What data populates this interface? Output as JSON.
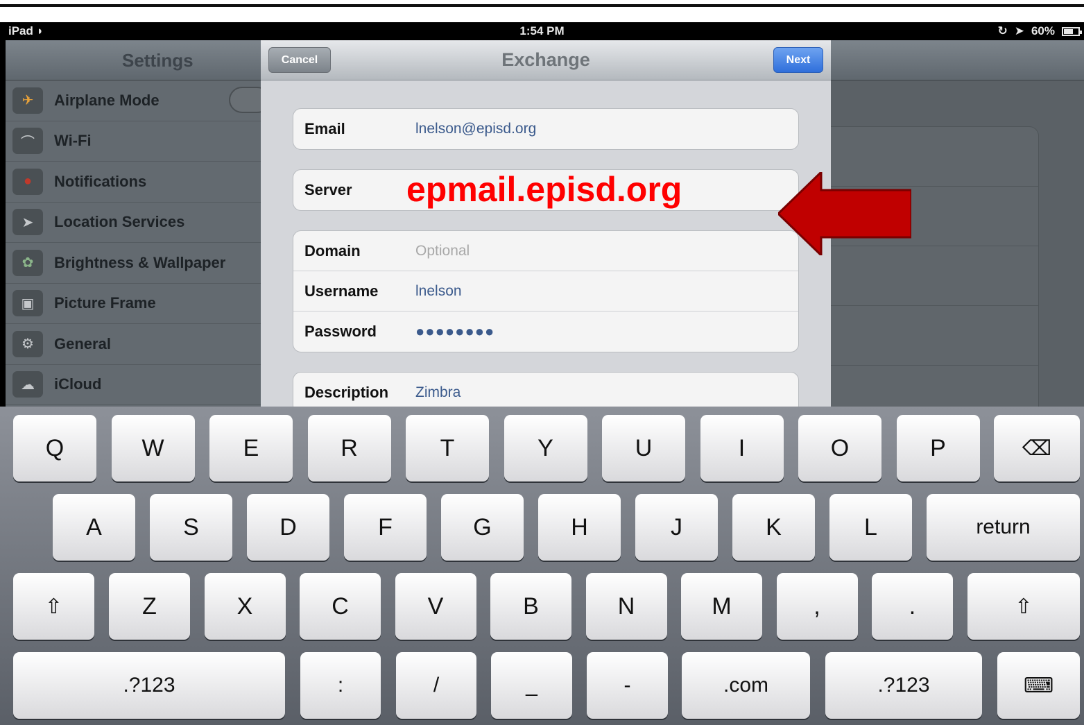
{
  "status_bar": {
    "device": "iPad",
    "time": "1:54 PM",
    "battery": "60%"
  },
  "settings": {
    "title": "Settings",
    "items": [
      {
        "label": "Airplane Mode",
        "icon": "airplane-icon"
      },
      {
        "label": "Wi-Fi",
        "icon": "wifi-icon"
      },
      {
        "label": "Notifications",
        "icon": "notifications-icon"
      },
      {
        "label": "Location Services",
        "icon": "location-icon"
      },
      {
        "label": "Brightness & Wallpaper",
        "icon": "wallpaper-icon"
      },
      {
        "label": "Picture Frame",
        "icon": "picture-frame-icon"
      },
      {
        "label": "General",
        "icon": "gear-icon"
      },
      {
        "label": "iCloud",
        "icon": "cloud-icon"
      }
    ]
  },
  "modal": {
    "title": "Exchange",
    "cancel_label": "Cancel",
    "next_label": "Next",
    "email": {
      "label": "Email",
      "value": "lnelson@episd.org"
    },
    "server": {
      "label": "Server",
      "value": "epmail.episd.org"
    },
    "domain": {
      "label": "Domain",
      "placeholder": "Optional"
    },
    "username": {
      "label": "Username",
      "value": "lnelson"
    },
    "password": {
      "label": "Password",
      "value": "●●●●●●●●"
    },
    "description": {
      "label": "Description",
      "value": "Zimbra"
    }
  },
  "keyboard": {
    "row1": [
      "Q",
      "W",
      "E",
      "R",
      "T",
      "Y",
      "U",
      "I",
      "O",
      "P"
    ],
    "row2": [
      "A",
      "S",
      "D",
      "F",
      "G",
      "H",
      "J",
      "K",
      "L"
    ],
    "return_label": "return",
    "row3": [
      "Z",
      "X",
      "C",
      "V",
      "B",
      "N",
      "M",
      ",",
      "."
    ],
    "row4": [
      ".?123",
      ":",
      "/",
      "_",
      "-",
      ".com",
      ".?123"
    ]
  },
  "colors": {
    "annotation": "#ff0000",
    "arrow": "#c00000",
    "next_button": "#2f6fdb"
  }
}
